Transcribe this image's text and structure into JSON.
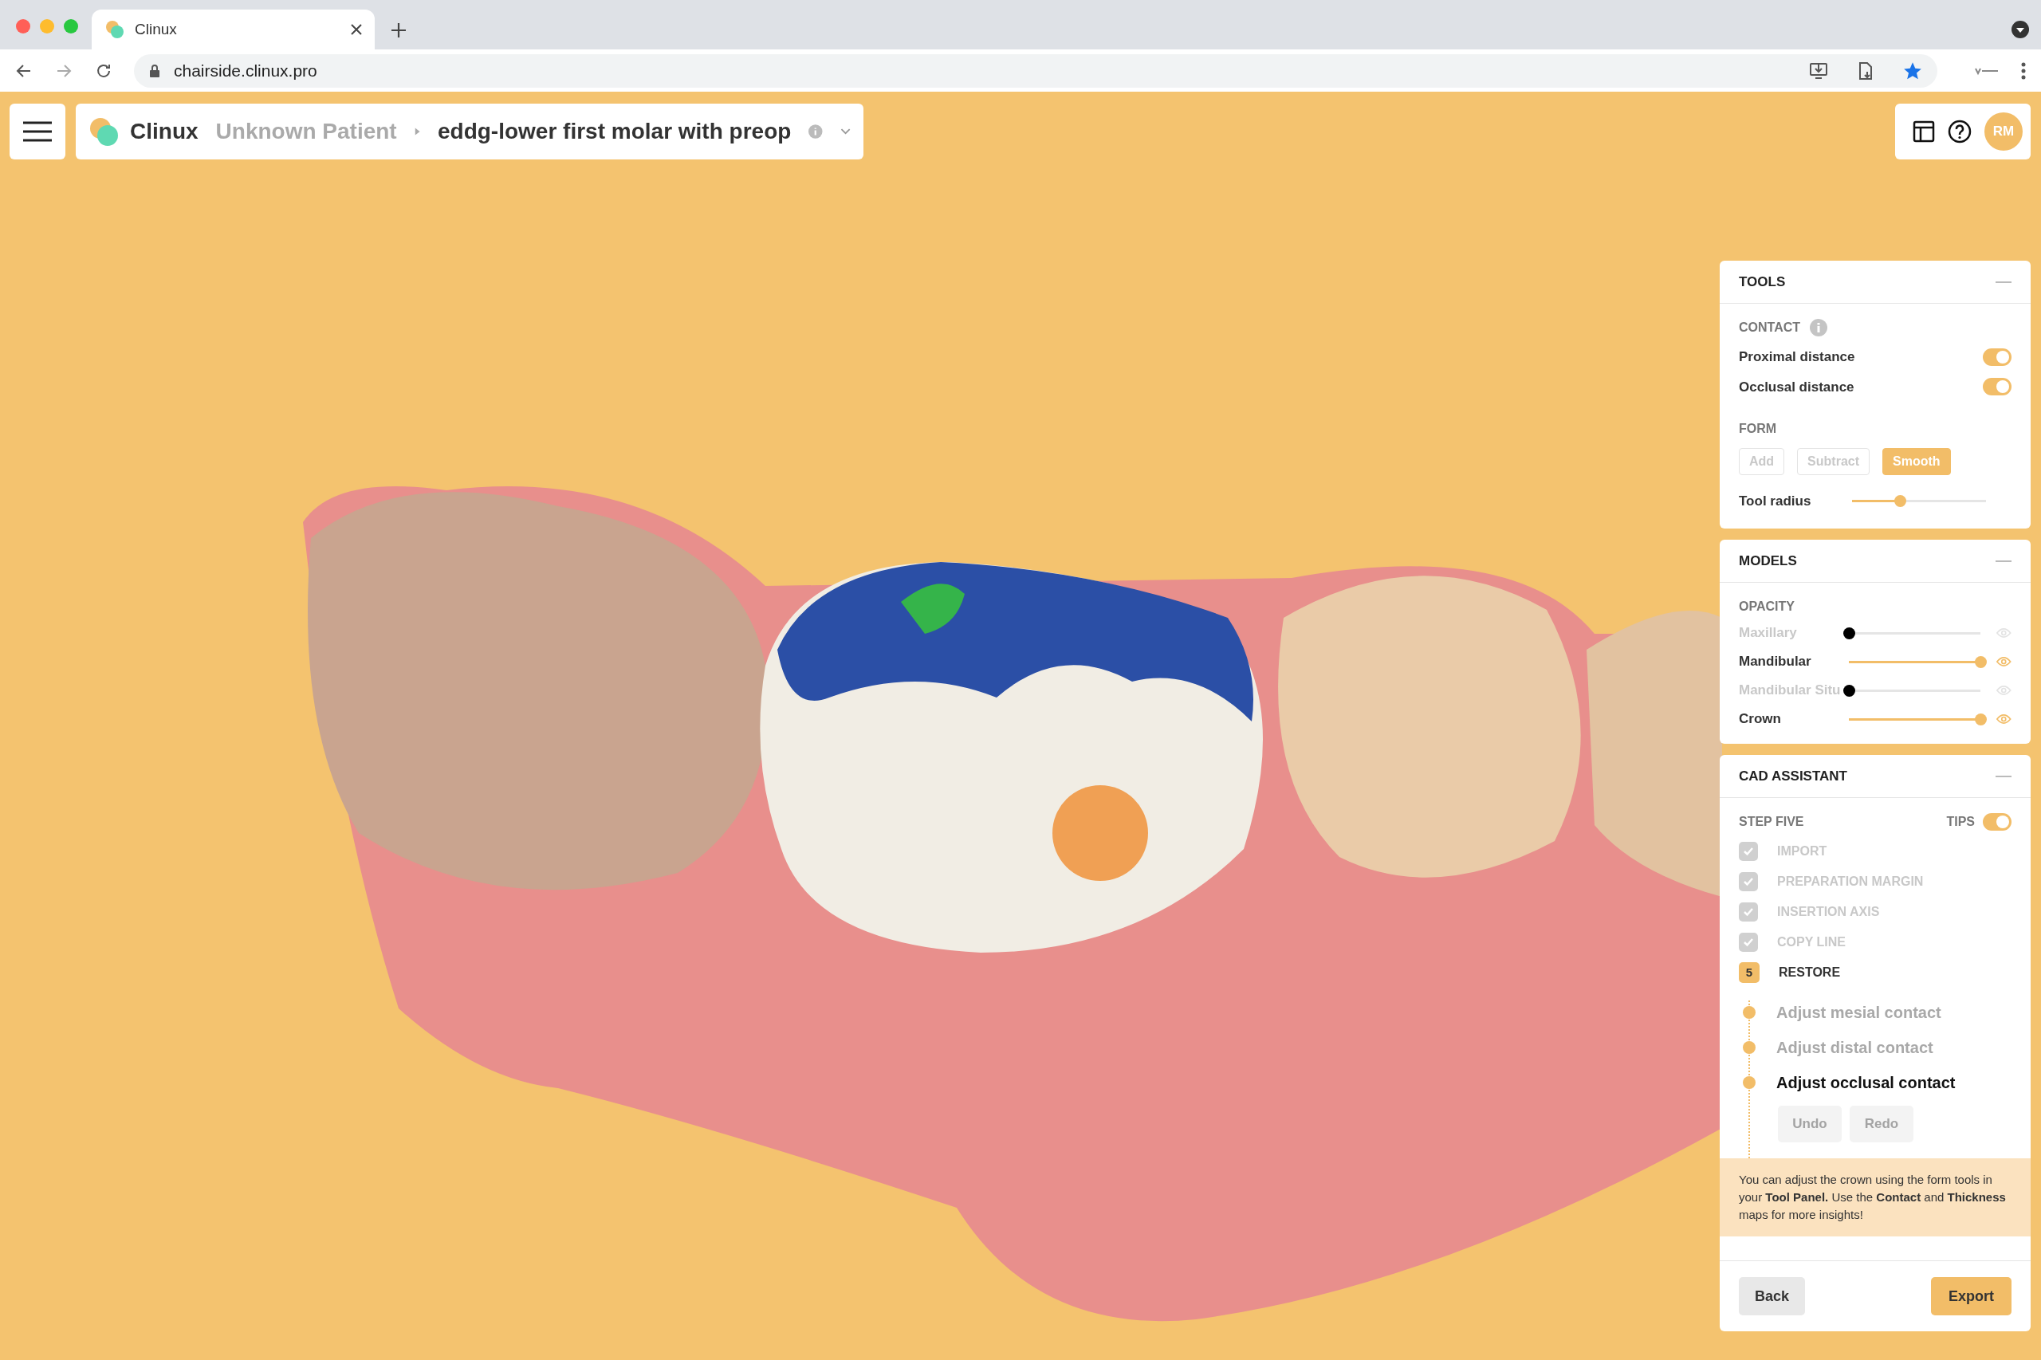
{
  "browser": {
    "tab_title": "Clinux",
    "url": "chairside.clinux.pro"
  },
  "header": {
    "brand": "Clinux",
    "patient": "Unknown Patient",
    "case_name": "eddg-lower first molar with preop",
    "avatar": "RM"
  },
  "tools": {
    "title": "TOOLS",
    "contact_label": "CONTACT",
    "toggles": [
      {
        "label": "Proximal distance",
        "on": true
      },
      {
        "label": "Occlusal distance",
        "on": true
      }
    ],
    "form_label": "FORM",
    "form_buttons": [
      {
        "label": "Add",
        "selected": false
      },
      {
        "label": "Subtract",
        "selected": false
      },
      {
        "label": "Smooth",
        "selected": true
      }
    ],
    "radius": {
      "label": "Tool radius",
      "level": 0.36
    }
  },
  "models": {
    "title": "MODELS",
    "opacity_label": "OPACITY",
    "rows": [
      {
        "label": "Maxillary",
        "visible": false,
        "level": 0
      },
      {
        "label": "Mandibular",
        "visible": true,
        "level": 1
      },
      {
        "label": "Mandibular Situ",
        "visible": false,
        "level": 0
      },
      {
        "label": "Crown",
        "visible": true,
        "level": 1
      }
    ]
  },
  "assistant": {
    "title": "CAD ASSISTANT",
    "step_label": "STEP FIVE",
    "tips": {
      "label": "TIPS",
      "on": true
    },
    "steps": [
      {
        "label": "IMPORT",
        "kind": "done"
      },
      {
        "label": "PREPARATION MARGIN",
        "kind": "done"
      },
      {
        "label": "INSERTION AXIS",
        "kind": "done"
      },
      {
        "label": "COPY LINE",
        "kind": "done"
      },
      {
        "label": "RESTORE",
        "kind": "current",
        "number": "5"
      }
    ],
    "substeps": [
      {
        "label": "Adjust mesial contact",
        "selected": false
      },
      {
        "label": "Adjust distal contact",
        "selected": false
      },
      {
        "label": "Adjust occlusal contact",
        "selected": true
      }
    ],
    "actions": [
      {
        "label": "Undo",
        "disabled": true
      },
      {
        "label": "Redo",
        "disabled": true
      }
    ],
    "tip": "You can adjust the crown using the form tools in your **Tool Panel.** Use the **Contact** and **Thickness** maps for more insights!",
    "back": "Back",
    "export": "Export"
  }
}
